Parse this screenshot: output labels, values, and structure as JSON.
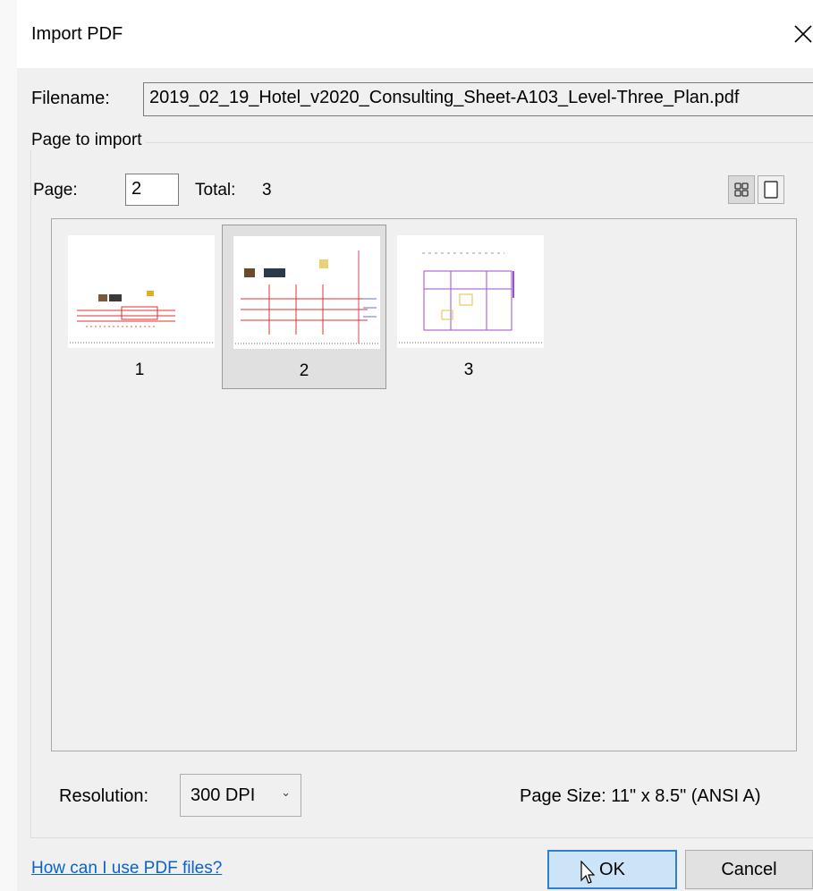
{
  "window": {
    "title": "Import PDF",
    "close": "close-icon"
  },
  "filename": {
    "label": "Filename:",
    "value": "2019_02_19_Hotel_v2020_Consulting_Sheet-A103_Level-Three_Plan.pdf"
  },
  "page_group": {
    "legend": "Page to import",
    "page_label": "Page:",
    "page_value": "2",
    "total_label": "Total:",
    "total_value": "3"
  },
  "thumbnails": [
    {
      "number": "1",
      "selected": false
    },
    {
      "number": "2",
      "selected": true
    },
    {
      "number": "3",
      "selected": false
    }
  ],
  "resolution": {
    "label": "Resolution:",
    "value": "300 DPI"
  },
  "page_size": "Page Size: 11\" x 8.5\" (ANSI A)",
  "help_link": "How can I use PDF files?",
  "buttons": {
    "ok": "OK",
    "cancel": "Cancel"
  },
  "colors": {
    "link": "#0b63c9",
    "ok_border": "#2f7fd0",
    "ok_bg": "#cce4f7"
  }
}
